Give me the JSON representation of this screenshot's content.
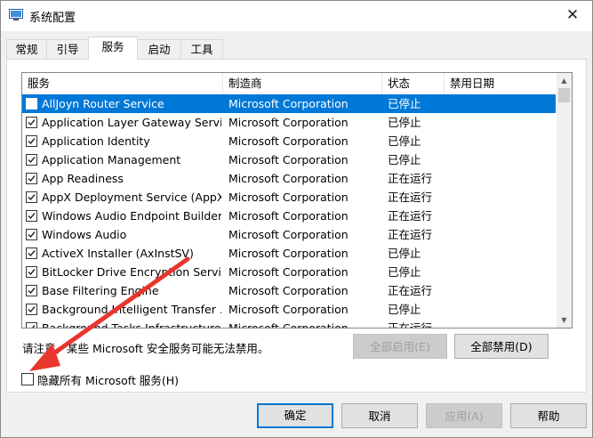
{
  "window": {
    "title": "系统配置",
    "close_glyph": "✕"
  },
  "tabs": [
    {
      "label": "常规"
    },
    {
      "label": "引导"
    },
    {
      "label": "服务"
    },
    {
      "label": "启动"
    },
    {
      "label": "工具"
    }
  ],
  "active_tab": "服务",
  "columns": {
    "service": "服务",
    "manufacturer": "制造商",
    "status": "状态",
    "disabled_date": "禁用日期"
  },
  "services": [
    {
      "name": "AllJoyn Router Service",
      "maker": "Microsoft Corporation",
      "status": "已停止",
      "checked": true,
      "selected": true
    },
    {
      "name": "Application Layer Gateway Service",
      "maker": "Microsoft Corporation",
      "status": "已停止",
      "checked": true
    },
    {
      "name": "Application Identity",
      "maker": "Microsoft Corporation",
      "status": "已停止",
      "checked": true
    },
    {
      "name": "Application Management",
      "maker": "Microsoft Corporation",
      "status": "已停止",
      "checked": true
    },
    {
      "name": "App Readiness",
      "maker": "Microsoft Corporation",
      "status": "正在运行",
      "checked": true
    },
    {
      "name": "AppX Deployment Service (AppX...",
      "maker": "Microsoft Corporation",
      "status": "正在运行",
      "checked": true
    },
    {
      "name": "Windows Audio Endpoint Builder",
      "maker": "Microsoft Corporation",
      "status": "正在运行",
      "checked": true
    },
    {
      "name": "Windows Audio",
      "maker": "Microsoft Corporation",
      "status": "正在运行",
      "checked": true
    },
    {
      "name": "ActiveX Installer (AxInstSV)",
      "maker": "Microsoft Corporation",
      "status": "已停止",
      "checked": true
    },
    {
      "name": "BitLocker Drive Encryption Service",
      "maker": "Microsoft Corporation",
      "status": "已停止",
      "checked": true
    },
    {
      "name": "Base Filtering Engine",
      "maker": "Microsoft Corporation",
      "status": "正在运行",
      "checked": true
    },
    {
      "name": "Background Intelligent Transfer ...",
      "maker": "Microsoft Corporation",
      "status": "已停止",
      "checked": true
    },
    {
      "name": "Background Tasks Infrastructure ...",
      "maker": "Microsoft Corporation",
      "status": "正在运行",
      "checked": true
    }
  ],
  "note": "请注意，某些 Microsoft 安全服务可能无法禁用。",
  "buttons": {
    "enable_all": "全部启用(E)",
    "disable_all": "全部禁用(D)",
    "ok": "确定",
    "cancel": "取消",
    "apply": "应用(A)",
    "help": "帮助"
  },
  "hide_ms": {
    "label": "隐藏所有 Microsoft 服务(H)",
    "checked": false
  },
  "colors": {
    "selection": "#0078d7",
    "arrow": "#e8362d"
  }
}
